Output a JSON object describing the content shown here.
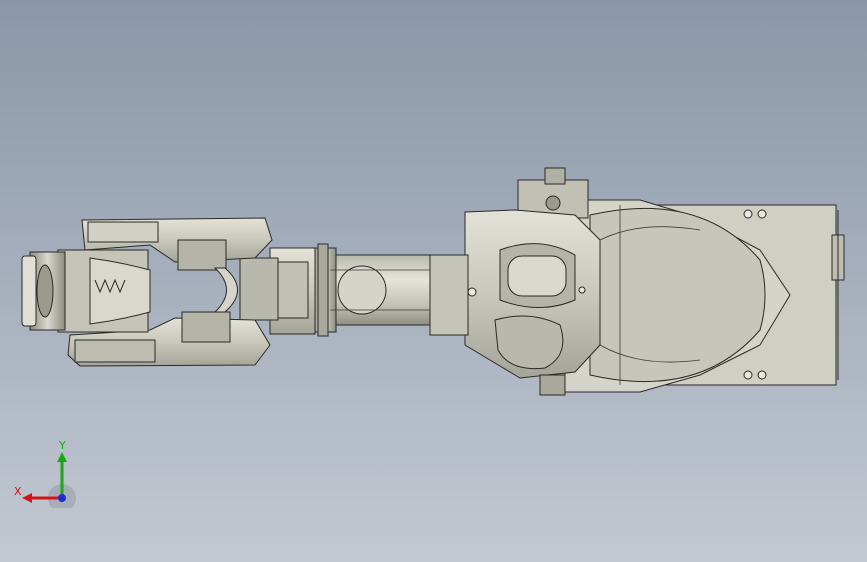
{
  "viewport": {
    "background_top": "#8a97a8",
    "background_bottom": "#c3c9d2",
    "model": "robot-arm-assembly",
    "view": "top"
  },
  "triad": {
    "x_label": "X",
    "y_label": "Y",
    "x_color": "#d0161a",
    "y_color": "#1aa81a",
    "z_color": "#1a2fd0"
  },
  "colors": {
    "metal_fill": "#c9c9bd",
    "metal_light": "#dcdcd2",
    "metal_dark": "#9e9e92",
    "edge": "#2a2a26"
  }
}
